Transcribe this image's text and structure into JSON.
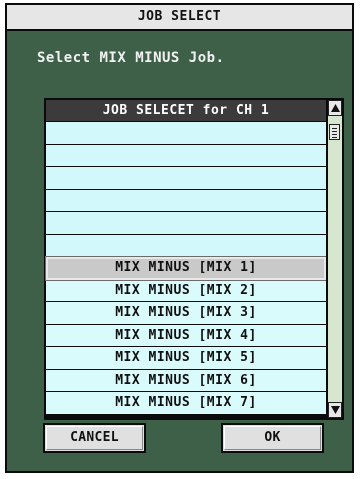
{
  "dialog": {
    "title": "JOB SELECT",
    "prompt": "Select MIX MINUS Job."
  },
  "list": {
    "header": "JOB SELECET for CH 1",
    "rows": [
      {
        "label": "",
        "selected": false
      },
      {
        "label": "",
        "selected": false
      },
      {
        "label": "",
        "selected": false
      },
      {
        "label": "",
        "selected": false
      },
      {
        "label": "",
        "selected": false
      },
      {
        "label": "",
        "selected": false
      },
      {
        "label": "MIX MINUS [MIX 1]",
        "selected": true
      },
      {
        "label": "MIX MINUS [MIX 2]",
        "selected": false
      },
      {
        "label": "MIX MINUS [MIX 3]",
        "selected": false
      },
      {
        "label": "MIX MINUS [MIX 4]",
        "selected": false
      },
      {
        "label": "MIX MINUS [MIX 5]",
        "selected": false
      },
      {
        "label": "MIX MINUS [MIX 6]",
        "selected": false
      },
      {
        "label": "MIX MINUS [MIX 7]",
        "selected": false
      }
    ]
  },
  "scrollbar": {
    "up_icon": "triangle-up-icon",
    "down_icon": "triangle-down-icon"
  },
  "buttons": {
    "cancel_label": "CANCEL",
    "ok_label": "OK"
  },
  "colors": {
    "dialog_bg": "#3f6048",
    "row_bg": "#d9fbfc",
    "selected_row_bg": "#c9c9c9",
    "header_bg": "#3b3b3b"
  }
}
